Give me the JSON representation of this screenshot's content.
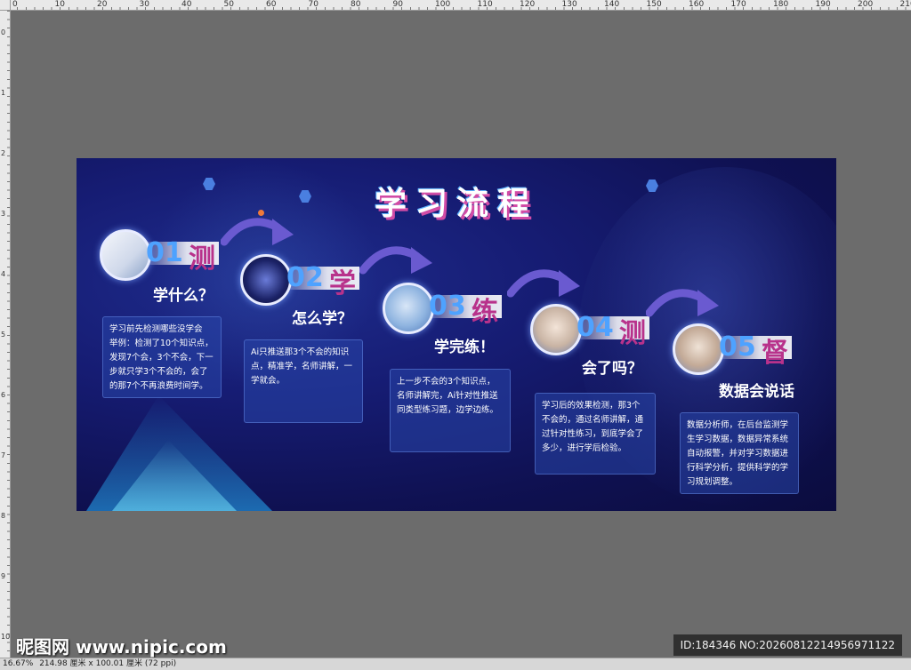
{
  "ruler": {
    "top_labels": [
      "0",
      "10",
      "20",
      "30",
      "40",
      "50",
      "60",
      "70",
      "80",
      "90",
      "100",
      "110",
      "120",
      "130",
      "140",
      "150",
      "160",
      "170",
      "180",
      "190",
      "200",
      "210"
    ],
    "left_labels": [
      "0",
      "1",
      "2",
      "3",
      "4",
      "5",
      "6",
      "7",
      "8",
      "9",
      "10"
    ]
  },
  "banner": {
    "title": "学习流程",
    "steps": [
      {
        "num": "01",
        "char": "测",
        "question": "学什么？",
        "text": "学习前先检测哪些没学会\n举例：检测了10个知识点，发现7个会，3个不会，下一步就只学3个不会的，会了的那7个不再浪费时间学。"
      },
      {
        "num": "02",
        "char": "学",
        "question": "怎么学？",
        "text": "Ai只推送那3个不会的知识点，精准学，名师讲解，一学就会。"
      },
      {
        "num": "03",
        "char": "练",
        "question": "学完练！",
        "text": "上一步不会的3个知识点，名师讲解完，Ai针对性推送同类型练习题，边学边练。"
      },
      {
        "num": "04",
        "char": "测",
        "question": "会了吗？",
        "text": "学习后的效果检测，那3个不会的，通过名师讲解，通过针对性练习，到底学会了多少，进行学后检验。"
      },
      {
        "num": "05",
        "char": "督",
        "question": "数据会说话",
        "text": "数据分析师，在后台监测学生学习数据，数据异常系统自动报警，并对学习数据进行科学分析，提供科学的学习规划调整。"
      }
    ]
  },
  "watermark": {
    "logo": "昵图网 www.nipic.com",
    "id_text": "ID:184346 NO:20260812214956971122"
  },
  "status": {
    "zoom": "16.67%",
    "doc_info": "214.98 厘米 x 100.01 厘米 (72 ppi)"
  },
  "colors": {
    "canvas_bg": "#6c6c6c",
    "banner_bg": "#161c73",
    "accent_blue": "#4ea2ff",
    "accent_magenta": "#b8328b"
  }
}
